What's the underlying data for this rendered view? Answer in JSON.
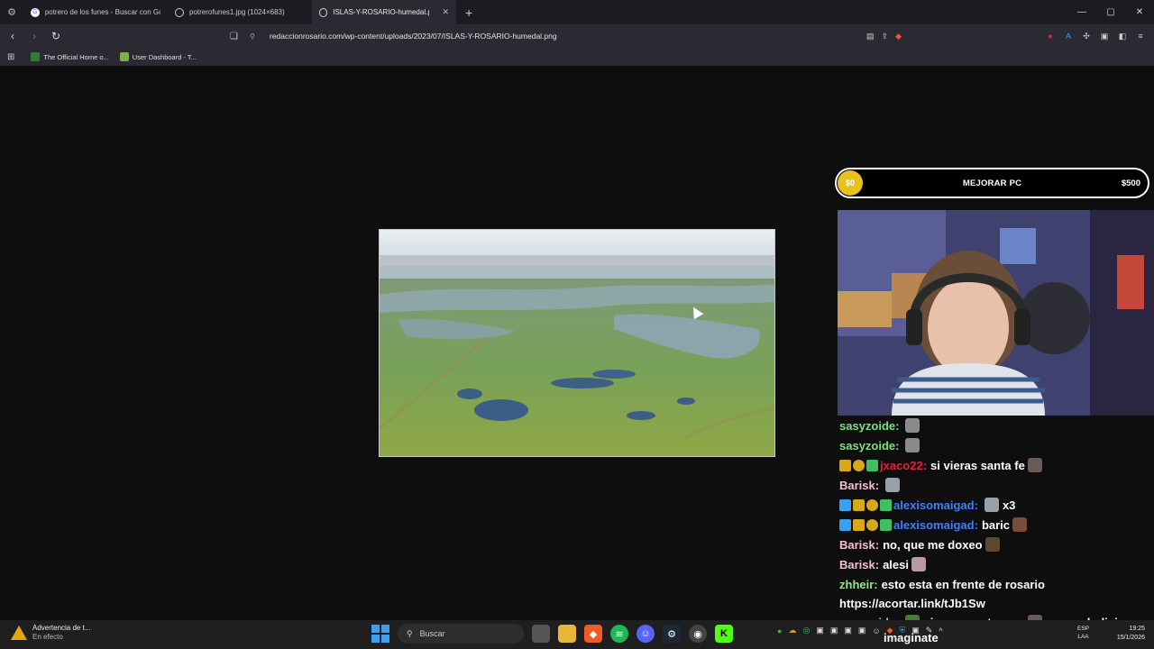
{
  "browser": {
    "tabs": [
      {
        "title": "potrero de los funes - Buscar con Go",
        "active": false,
        "favicon": "google-icon"
      },
      {
        "title": "potrerofunes1.jpg (1024×683)",
        "active": false,
        "favicon": "globe-icon"
      },
      {
        "title": "ISLAS-Y-ROSARIO-humedal.png",
        "active": true,
        "favicon": "globe-icon"
      }
    ],
    "new_tab_glyph": "+",
    "close_glyph": "✕",
    "url": "redaccionrosario.com/wp-content/uploads/2023/07/ISLAS-Y-ROSARIO-humedal.png",
    "bookmarks": [
      {
        "label": "The Official Home o...",
        "color": "#2e7d32"
      },
      {
        "label": "User Dashboard - T...",
        "color": "#7cb342"
      }
    ]
  },
  "overlay": {
    "goal": {
      "current": "$0",
      "label": "MEJORAR PC",
      "target": "$500"
    }
  },
  "chat": {
    "messages": [
      {
        "user": "sasyzoide:",
        "user_color": "#7be37b",
        "text": "",
        "badges": [],
        "emotes": [
          "#8a8a8a"
        ]
      },
      {
        "user": "sasyzoide:",
        "user_color": "#7be37b",
        "text": "",
        "badges": [],
        "emotes": [
          "#8a8a8a"
        ]
      },
      {
        "user": "jxaco22:",
        "user_color": "#e0243b",
        "text": "si vieras santa fe",
        "badges": [
          "#d8a81a",
          "#d8a81a",
          "#3fbf5f"
        ],
        "emotes": [
          "#6a5a55"
        ]
      },
      {
        "user": "Barisk:",
        "user_color": "#f2c1cf",
        "text": "",
        "badges": [],
        "emotes": [
          "#9aa0a8"
        ]
      },
      {
        "user": "alexisomaigad:",
        "user_color": "#3b82f6",
        "text": "x3",
        "badges": [
          "#3aa0f2",
          "#d8a81a",
          "#d8a81a",
          "#3fbf5f"
        ],
        "emotes": [
          "#9aa0a8"
        ]
      },
      {
        "user": "alexisomaigad:",
        "user_color": "#3b82f6",
        "text": "baric",
        "badges": [
          "#3aa0f2",
          "#d8a81a",
          "#d8a81a",
          "#3fbf5f"
        ],
        "emotes": [
          "#7a4a3a"
        ]
      },
      {
        "user": "Barisk:",
        "user_color": "#f2c1cf",
        "text": "no, que me doxeo",
        "badges": [],
        "emotes": [
          "#5a4a30"
        ]
      },
      {
        "user": "Barisk:",
        "user_color": "#f2c1cf",
        "text": "alesi",
        "badges": [],
        "emotes": [
          "#b89aa0"
        ]
      },
      {
        "user": "zhheir:",
        "user_color": "#9be38f",
        "text": "esto esta en frente de rosario",
        "badges": [],
        "emotes": []
      }
    ],
    "link": "https://acortar.link/tJb1Sw",
    "last": {
      "user": "sasyzoide:",
      "user_color": "#7be37b",
      "text_a": "vivo en santa cruz",
      "text_b": "parece bolivia",
      "text_c": "imaginate"
    }
  },
  "taskbar": {
    "warning_title": "Advertencia de t...",
    "warning_sub": "En efecto",
    "search_label": "Buscar",
    "lang_top": "ESP",
    "lang_bottom": "LAA",
    "time": "19:25",
    "date": "15/1/2026"
  }
}
